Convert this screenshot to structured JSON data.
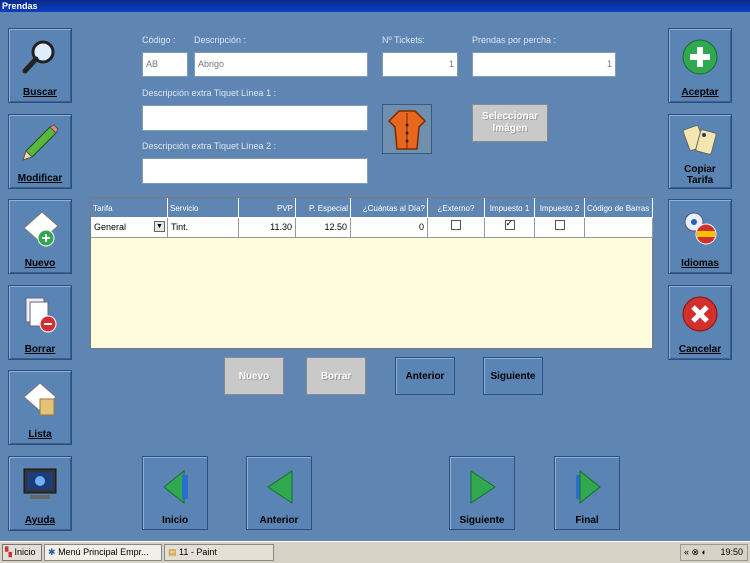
{
  "window": {
    "title": "Prendas"
  },
  "fields": {
    "codigo_label": "Código :",
    "codigo_value": "AB",
    "descripcion_label": "Descripción :",
    "descripcion_value": "Abrigo",
    "tickets_label": "Nº Tickets:",
    "tickets_value": "1",
    "perchas_label": "Prendas por percha :",
    "perchas_value": "1",
    "extra1_label": "Descripción extra Tiquet Línea 1 :",
    "extra1_value": "",
    "extra2_label": "Descripción extra Tiquet Línea 2 :",
    "extra2_value": ""
  },
  "image_button": {
    "icon": "coat-icon",
    "select_label_1": "Seleccionar",
    "select_label_2": "Imágen"
  },
  "left_buttons": [
    {
      "label": "Buscar",
      "icon": "magnifier-icon"
    },
    {
      "label": "Modificar",
      "icon": "pencil-icon"
    },
    {
      "label": "Nuevo",
      "icon": "new-doc-icon"
    },
    {
      "label": "Borrar",
      "icon": "delete-doc-icon"
    },
    {
      "label": "Lista",
      "icon": "list-icon"
    },
    {
      "label": "Ayuda",
      "icon": "help-monitor-icon"
    }
  ],
  "right_buttons": [
    {
      "label": "Aceptar",
      "icon": "plus-icon"
    },
    {
      "label_1": "Copiar",
      "label_2": "Tarifa",
      "icon": "copy-tags-icon"
    },
    {
      "label": "Idiomas",
      "icon": "flags-icon"
    },
    {
      "label": "Cancelar",
      "icon": "x-icon"
    }
  ],
  "grid": {
    "columns": [
      "Tarifa",
      "Servicio",
      "PVP",
      "P. Especial",
      "¿Cuántas al Día?",
      "¿Externo?",
      "Impuesto 1",
      "Impuesto 2",
      "Código de Barras"
    ],
    "rows": [
      {
        "tarifa": "General",
        "servicio": "Tint.",
        "pvp": "11.30",
        "especial": "12.50",
        "cuantas": "0",
        "externo": false,
        "impuesto1": true,
        "impuesto2": false,
        "codigo": ""
      }
    ]
  },
  "row_buttons": {
    "nuevo": "Nuevo",
    "borrar": "Borrar",
    "anterior": "Anterior",
    "siguiente": "Siguiente"
  },
  "nav_buttons": {
    "inicio": "Inicio",
    "anterior": "Anterior",
    "siguiente": "Siguiente",
    "final": "Final"
  },
  "colors": {
    "background": "#5f86b2",
    "grid_bg": "#fffbdc",
    "nav_arrow": "#2fa84f"
  },
  "taskbar": {
    "start": "Inicio",
    "item1": "Menú Principal  Empr...",
    "item2": "11 - Paint",
    "clock": "19:50"
  }
}
